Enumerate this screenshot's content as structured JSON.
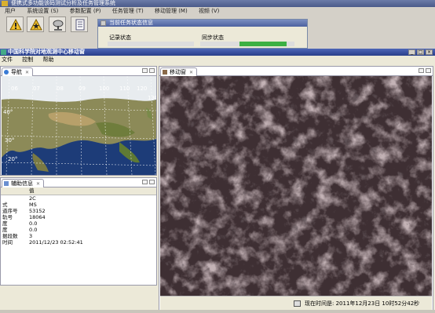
{
  "bg_window": {
    "title": "便携式多功能该码测试分析及任务管理系统",
    "menu": [
      "用户",
      "系统设置 (S)",
      "参数配置 (P)",
      "任务管理 (T)",
      "移动管理 (M)",
      "视频 (V)"
    ],
    "toolbar_icons": [
      "warning-icon",
      "warning-star-icon",
      "satellite-dish-icon",
      "document-icon"
    ]
  },
  "status_dialog": {
    "title": "当前任务状态信息",
    "record_group": "记录状态",
    "sync_group": "同步状态"
  },
  "main_window": {
    "title": "中国科学院对地观测中心移动窗",
    "menu": [
      "文件",
      "控制",
      "帮助"
    ]
  },
  "nav_panel": {
    "tab_label": "导航",
    "lon_labels": [
      "06",
      "07",
      "08",
      "09",
      "100",
      "110",
      "120",
      "130"
    ],
    "lat_labels": [
      "40°",
      "30°",
      "20°"
    ]
  },
  "aux_panel": {
    "tab_label": "辅助信息",
    "header_value": "值",
    "rows": [
      {
        "key": "",
        "value": "2C"
      },
      {
        "key": "式",
        "value": "MS"
      },
      {
        "key": "道序号",
        "value": "53152"
      },
      {
        "key": "轨号",
        "value": "18064"
      },
      {
        "key": "度",
        "value": "0.0"
      },
      {
        "key": "度",
        "value": "0.0"
      },
      {
        "key": "据段数",
        "value": "3"
      },
      {
        "key": "时间",
        "value": "2011/12/23 02:52:41"
      }
    ]
  },
  "mobile_panel": {
    "tab_label": "移动窗",
    "status_text": "现在时间是: 2011年12月23日  10时52分42秒"
  },
  "colors": {
    "title_bar": "#2a3f8a",
    "panel_bg": "#ece9d8",
    "satellite": "#3e2f33"
  }
}
